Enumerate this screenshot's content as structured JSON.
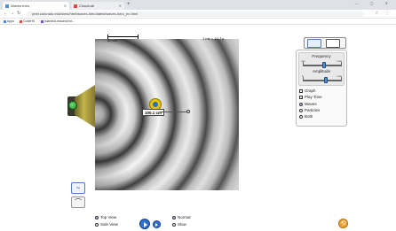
{
  "browser": {
    "tabs": [
      {
        "label": "Waves Intro"
      },
      {
        "label": "CloudLab"
      }
    ],
    "url": "phet.colorado.edu/sims/html/waves-intro/latest/waves-intro_en.html",
    "bookmarks": [
      {
        "label": "Apps"
      },
      {
        "label": "CodeHS"
      },
      {
        "label": "Islands/Lessons/Ind..."
      }
    ],
    "window_controls": "— ▢ ✕"
  },
  "sim": {
    "measure_label": "50 cm",
    "time_label": "1 ms = 10⁻³ s",
    "probe_readout": "100.1 cm",
    "frequency": {
      "title": "Frequency",
      "min_label": "min",
      "max_label": "max",
      "value_fraction": 0.55
    },
    "amplitude": {
      "title": "Amplitude",
      "min_label": "0",
      "max_label": "max",
      "value_fraction": 0.6
    },
    "options": {
      "graph": {
        "label": "Graph",
        "checked": false
      },
      "play_tone": {
        "label": "Play Tone",
        "checked": true
      },
      "view_mode": [
        {
          "label": "Waves",
          "selected": true
        },
        {
          "label": "Particles",
          "selected": false
        },
        {
          "label": "Both",
          "selected": false
        }
      ]
    },
    "viewpoint": [
      {
        "label": "Top View",
        "selected": true
      },
      {
        "label": "Side View",
        "selected": false
      }
    ],
    "speed": [
      {
        "label": "Normal",
        "selected": true
      },
      {
        "label": "Slow",
        "selected": false
      }
    ]
  },
  "icons": {
    "graph_wave": "~",
    "graph_pulse": "⌒",
    "reset": "⟲"
  },
  "colors": {
    "accent": "#2f6fd0",
    "speaker_button": "#1f8a2b",
    "probe": "#e6c200",
    "reset": "#f0a330"
  }
}
